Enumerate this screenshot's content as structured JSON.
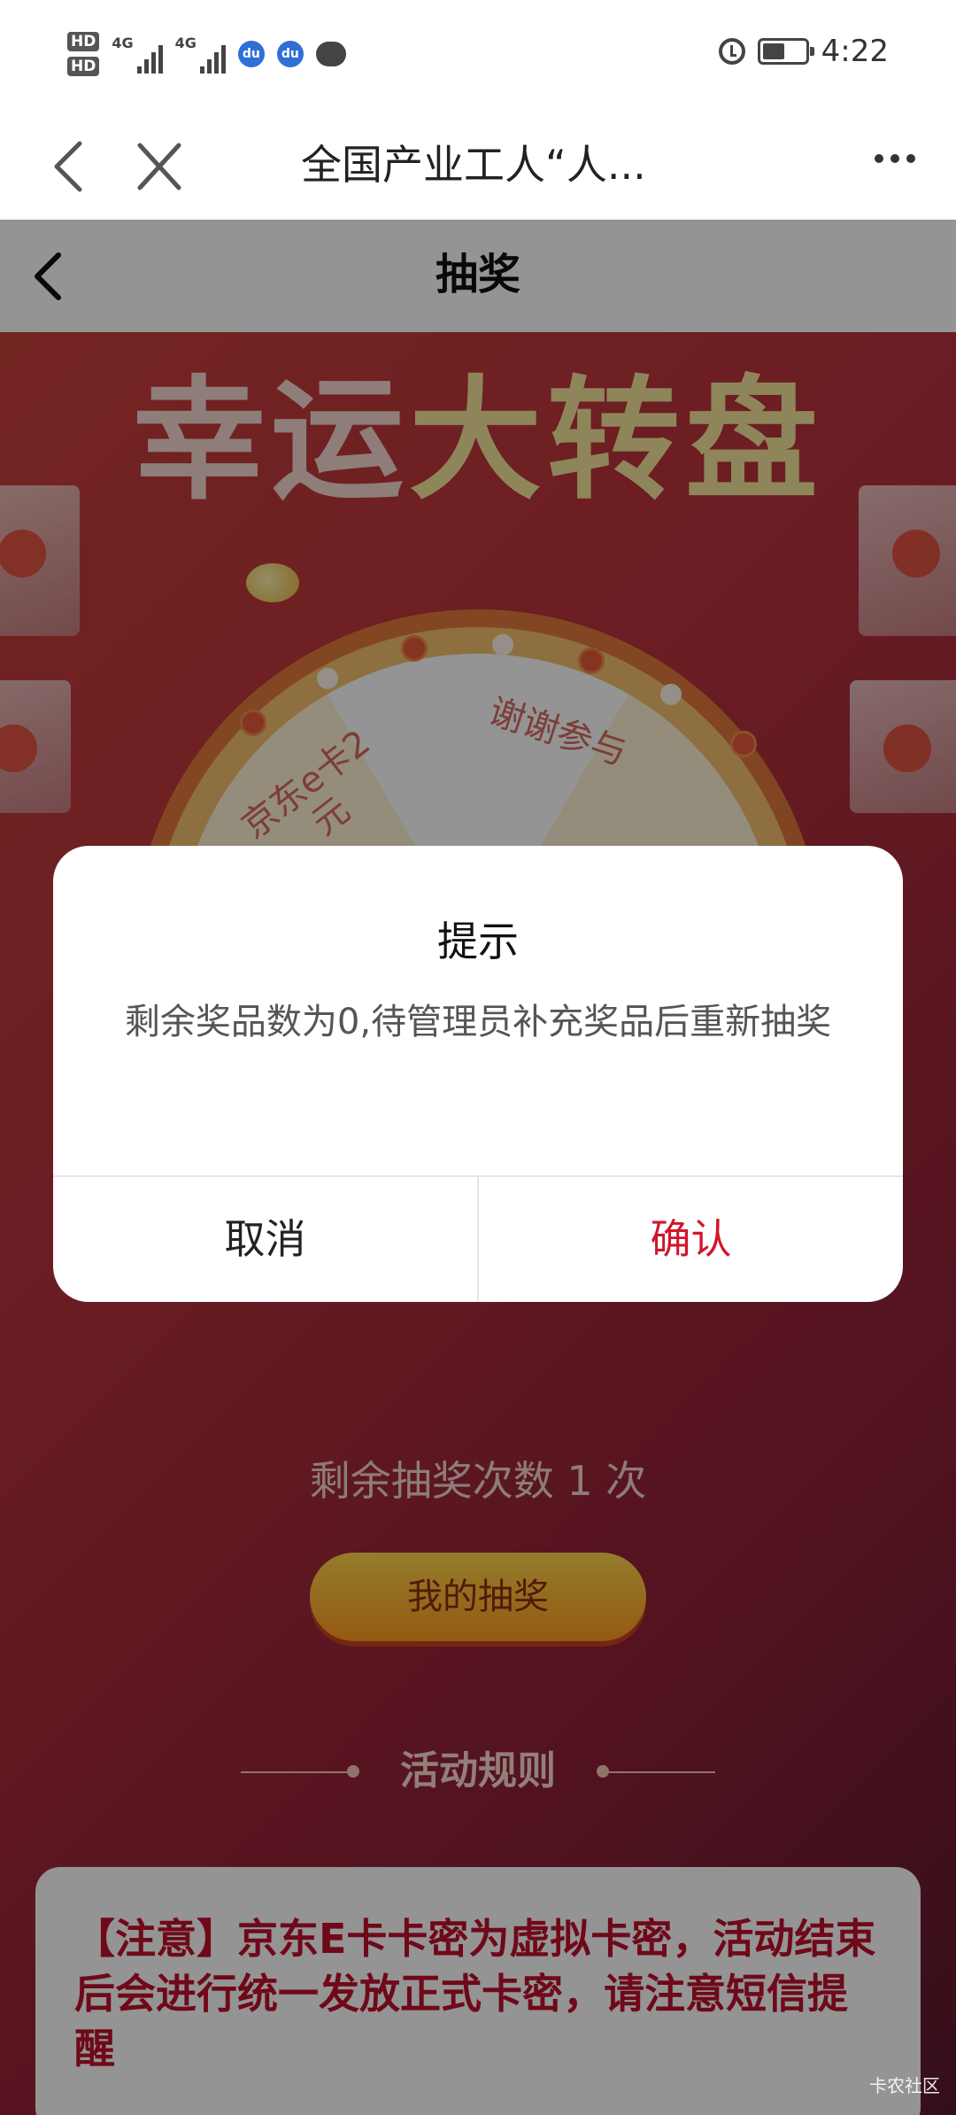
{
  "status_bar": {
    "sim1": "HD",
    "sim2": "HD",
    "net1": "4G",
    "net2": "4G",
    "time": "4:22",
    "icons": [
      "baidu-icon",
      "baidu-icon",
      "message-icon",
      "alarm-icon",
      "battery-icon"
    ]
  },
  "webview": {
    "title": "全国产业工人“人..."
  },
  "page": {
    "header_title": "抽奖",
    "banner_a": "幸运",
    "banner_b": "大转盘",
    "slice_prize": "京东e卡2元",
    "slice_thanks": "谢谢参与",
    "remaining_text": "剩余抽奖次数 1 次",
    "my_draw_button": "我的抽奖",
    "rules_title": "活动规则",
    "notice": "【注意】京东E卡卡密为虚拟卡密，活动结束后会进行统一发放正式卡密，请注意短信提醒"
  },
  "dialog": {
    "title": "提示",
    "message": "剩余奖品数为0,待管理员补充奖品后重新抽奖",
    "cancel_label": "取消",
    "confirm_label": "确认"
  },
  "colors": {
    "confirm": "#d0162c",
    "background_red": "#b7313d"
  },
  "watermark": "卡农社区"
}
